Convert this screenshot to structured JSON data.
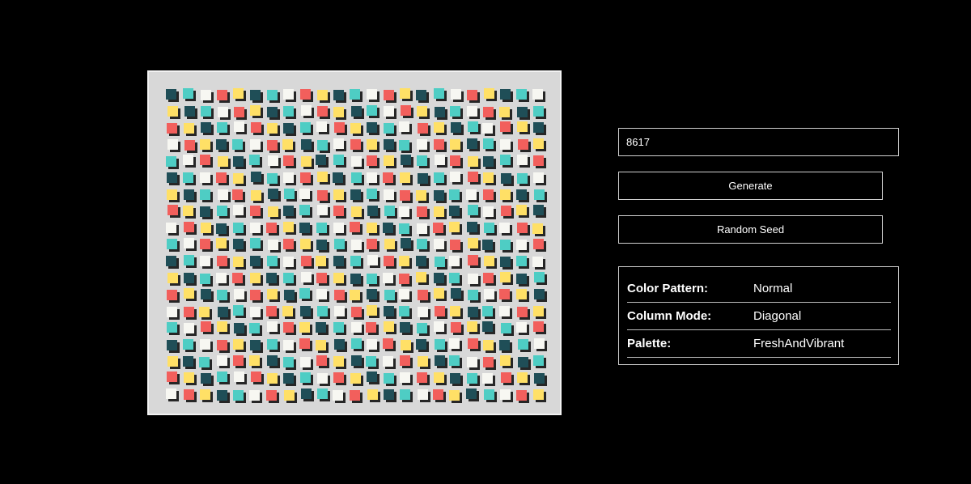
{
  "artwork": {
    "columns": 23,
    "rows": 19,
    "tile_colors": [
      "#1f4e57",
      "#4ecdc4",
      "#f7f7f2",
      "#f25f5c",
      "#ffe066"
    ],
    "background": "#d8d8d8",
    "shadow": "#262626"
  },
  "controls": {
    "seed_value": "8617",
    "generate_label": "Generate",
    "random_seed_label": "Random Seed"
  },
  "info": {
    "rows": [
      {
        "label": "Color Pattern:",
        "value": "Normal"
      },
      {
        "label": "Column Mode:",
        "value": "Diagonal"
      },
      {
        "label": "Palette:",
        "value": "FreshAndVibrant"
      }
    ]
  }
}
